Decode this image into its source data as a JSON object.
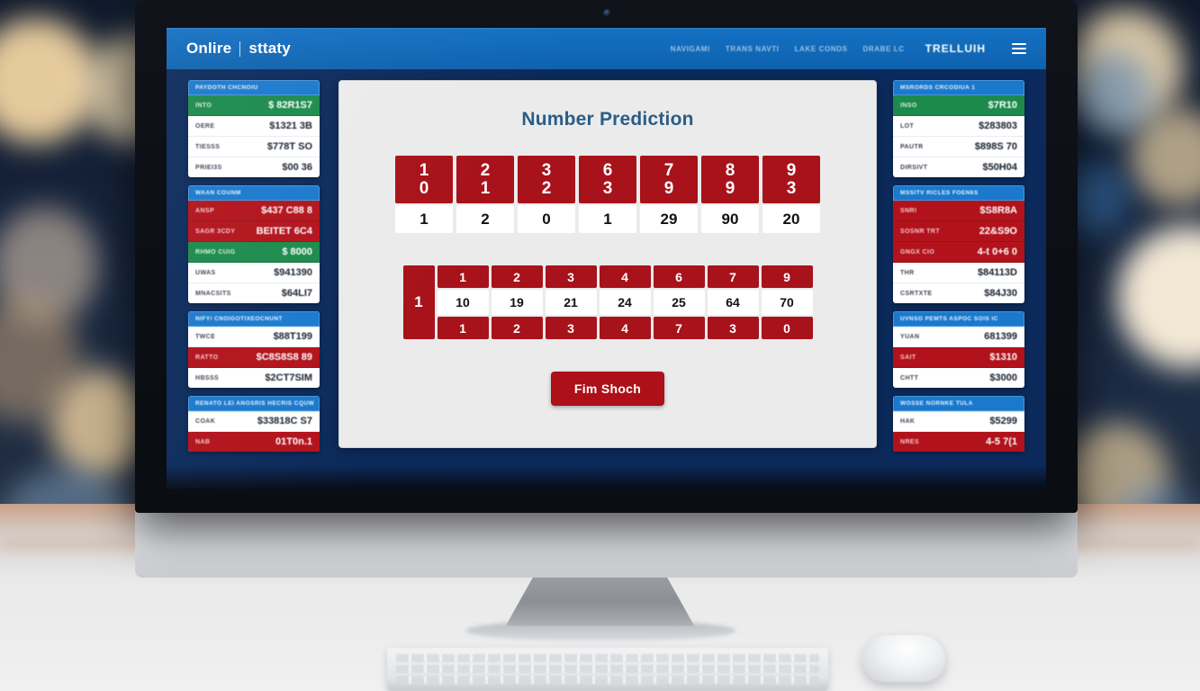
{
  "browser": {
    "brand_1": "Onlire",
    "brand_2": "sttaty",
    "nav_links": [
      "NAVIGAMI",
      "TRANS NAVTI",
      "LAKE CONDS",
      "DRABE LC"
    ],
    "nav_logo": "TRELLUIH",
    "menu_icon": "hamburger-icon"
  },
  "main": {
    "title": "Number Prediction",
    "grid_a": {
      "top": [
        "10",
        "21",
        "32",
        "63",
        "79",
        "89",
        "93"
      ],
      "bottom": [
        "1",
        "2",
        "0",
        "1",
        "29",
        "90",
        "20"
      ]
    },
    "grid_b": {
      "first": "1",
      "top": [
        "1",
        "2",
        "3",
        "4",
        "6",
        "7",
        "9"
      ],
      "middle": [
        "10",
        "19",
        "21",
        "24",
        "25",
        "64",
        "70"
      ],
      "bottom": [
        "1",
        "2",
        "3",
        "4",
        "7",
        "3",
        "0"
      ]
    },
    "button_label": "Fim Shoch"
  },
  "sidebar_left": [
    {
      "header": "PAYDOTH CHCNOIU",
      "rows": [
        {
          "label": "INTO",
          "value": "$ 82R1S7",
          "style": "green"
        },
        {
          "label": "OERE",
          "value": "$1321 3B",
          "style": "white"
        },
        {
          "label": "TIESSS",
          "value": "$778T SO",
          "style": "white"
        },
        {
          "label": "PRIEI3S",
          "value": "$00 36",
          "style": "white"
        }
      ]
    },
    {
      "header": "WAAN COUNM",
      "rows": [
        {
          "label": "ANSP",
          "value": "$437 C88 8",
          "style": "red"
        },
        {
          "label": "SAGR 3CDY",
          "value": "BEITET 6C4",
          "style": "red"
        },
        {
          "label": "RHMO CUIG",
          "value": "$ 8000",
          "style": "green"
        },
        {
          "label": "UWAS",
          "value": "$941390",
          "style": "white"
        },
        {
          "label": "MNACSITS",
          "value": "$64LI7",
          "style": "white"
        }
      ]
    },
    {
      "header": "NIFY/ CNOIGOTIXEOCNUNT",
      "rows": [
        {
          "label": "TWCE",
          "value": "$88T199",
          "style": "white"
        },
        {
          "label": "RATTO",
          "value": "$C8S8S8 89",
          "style": "red"
        },
        {
          "label": "HBSSS",
          "value": "$2CT7SIM",
          "style": "white"
        }
      ]
    },
    {
      "header": "RENATO LEI ANOSRIS HECRIS CQUW",
      "rows": [
        {
          "label": "COAK",
          "value": "$33818C S7",
          "style": "white"
        },
        {
          "label": "NAB",
          "value": "01T0n.1",
          "style": "red"
        }
      ]
    }
  ],
  "sidebar_right": [
    {
      "header": "MSRORDS CRCODIUA 1",
      "rows": [
        {
          "label": "INSO",
          "value": "$7R10",
          "style": "green"
        },
        {
          "label": "LOT",
          "value": "$283803",
          "style": "white"
        },
        {
          "label": "PAUTR",
          "value": "$898S 70",
          "style": "white"
        },
        {
          "label": "DIRSIVT",
          "value": "$50H04",
          "style": "white"
        }
      ]
    },
    {
      "header": "MSSITV RICLES FOEN6S",
      "rows": [
        {
          "label": "SNRI",
          "value": "$S8R8A",
          "style": "red"
        },
        {
          "label": "SOSNR TRT",
          "value": "22&S9O",
          "style": "red"
        },
        {
          "label": "GNGX CIO",
          "value": "4-t 0+6 0",
          "style": "red"
        },
        {
          "label": "THR",
          "value": "$84113D",
          "style": "white"
        },
        {
          "label": "CSRTXTE",
          "value": "$84J30",
          "style": "white"
        }
      ]
    },
    {
      "header": "UVNSO PEMTS ASPOC SOIS IC",
      "rows": [
        {
          "label": "YUAN",
          "value": "681399",
          "style": "white"
        },
        {
          "label": "SAIT",
          "value": "$1310",
          "style": "red"
        },
        {
          "label": "CHTT",
          "value": "$3000",
          "style": "white"
        }
      ]
    },
    {
      "header": "WOSSE NORNKE TULA",
      "rows": [
        {
          "label": "HAK",
          "value": "$5299",
          "style": "white"
        },
        {
          "label": "NRES",
          "value": "4-5 7(1",
          "style": "red"
        }
      ]
    }
  ],
  "colors": {
    "brand_blue": "#0e62ae",
    "page_blue": "#0b2a5b",
    "accent_red": "#a8121a",
    "accent_green": "#1b8a4b",
    "panel_bg": "#ebebeb",
    "title_blue": "#2a5d86"
  }
}
